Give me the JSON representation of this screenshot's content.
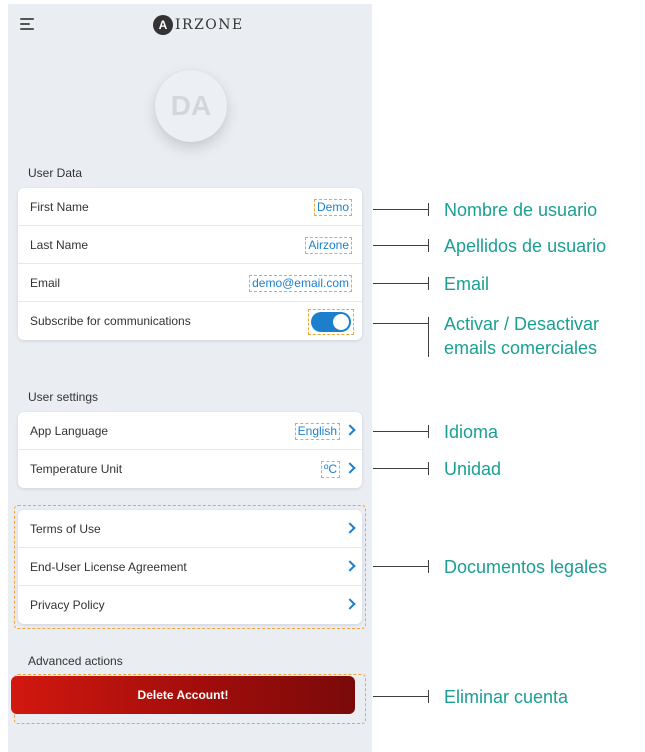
{
  "app": {
    "brand_letter": "A",
    "brand_name": "IRZONE"
  },
  "avatar": {
    "initials": "DA"
  },
  "user_data": {
    "title": "User Data",
    "rows": [
      {
        "label": "First Name",
        "value": "Demo"
      },
      {
        "label": "Last Name",
        "value": "Airzone"
      },
      {
        "label": "Email",
        "value": "demo@email.com"
      },
      {
        "label": "Subscribe for communications",
        "toggle_on": true
      }
    ]
  },
  "user_settings": {
    "title": "User settings",
    "rows": [
      {
        "label": "App Language",
        "value": "English"
      },
      {
        "label": "Temperature Unit",
        "value": "ºC"
      }
    ]
  },
  "legal": {
    "rows": [
      {
        "label": "Terms of Use"
      },
      {
        "label": "End-User License Agreement"
      },
      {
        "label": "Privacy Policy"
      }
    ]
  },
  "advanced": {
    "title": "Advanced actions",
    "delete_label": "Delete Account!"
  },
  "callouts": {
    "first_name": "Nombre de usuario",
    "last_name": "Apellidos de usuario",
    "email": "Email",
    "subscribe_line1": "Activar / Desactivar",
    "subscribe_line2": "emails comerciales",
    "language": "Idioma",
    "unit": "Unidad",
    "legal": "Documentos legales",
    "delete": "Eliminar cuenta"
  },
  "colors": {
    "accent": "#1b7fce",
    "annotation": "#1a9f93",
    "danger": "#c0140d",
    "highlight": "#f0a53b"
  }
}
